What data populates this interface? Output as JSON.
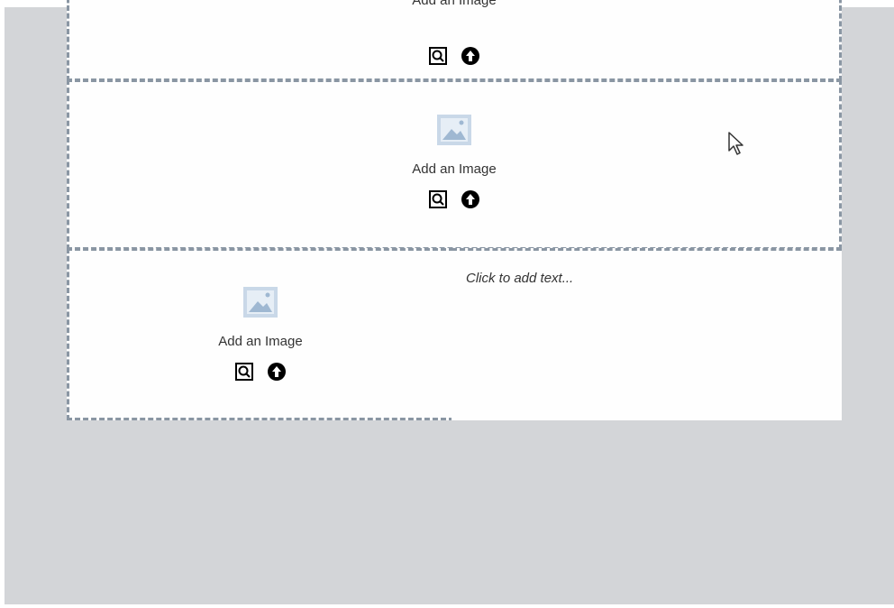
{
  "blocks": {
    "top_image": {
      "label": "Add an Image"
    },
    "middle_image": {
      "label": "Add an Image"
    },
    "bottom_left_image": {
      "label": "Add an Image"
    },
    "bottom_right_text": {
      "placeholder": "Click to add text..."
    }
  },
  "icons": {
    "placeholder": "image-placeholder-icon",
    "search": "search-image-icon",
    "upload": "upload-icon",
    "cursor": "mouse-cursor-icon"
  },
  "colors": {
    "canvas": "#d3d5d8",
    "block": "#fefefe",
    "dashed": "#8a96a3",
    "placeholder_icon": "#c9d8e8"
  }
}
